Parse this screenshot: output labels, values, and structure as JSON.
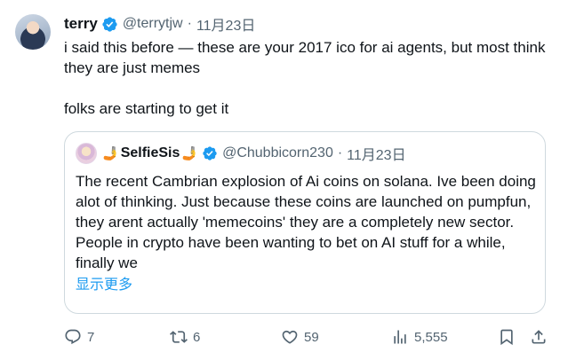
{
  "tweet": {
    "author": {
      "name": "terry",
      "handle": "@terrytjw",
      "date": "11月23日"
    },
    "lines": [
      "i said this before — these are your 2017 ico for ai agents, but most think they are just memes",
      "folks are starting to get it"
    ],
    "quote": {
      "emoji_left": "🤳",
      "name": "SelfieSis",
      "emoji_right": "🤳",
      "handle": "@Chubbicorn230",
      "date": "11月23日",
      "text": "The recent Cambrian explosion of Ai coins on solana. Ive been doing alot of thinking. Just because these coins are launched on pumpfun, they arent actually 'memecoins' they are a completely new sector. People in crypto have been wanting to bet on AI stuff for a while, finally we",
      "show_more": "显示更多"
    },
    "actions": {
      "replies": "7",
      "reposts": "6",
      "likes": "59",
      "views": "5,555"
    },
    "separator": "·"
  },
  "colors": {
    "verified": "#1d9bf0",
    "secondary_text": "#536471",
    "link": "#1d9bf0",
    "border": "#cfd9de"
  },
  "icons": [
    "verified-badge-icon",
    "reply-icon",
    "repost-icon",
    "like-icon",
    "views-icon",
    "bookmark-icon",
    "share-icon"
  ]
}
